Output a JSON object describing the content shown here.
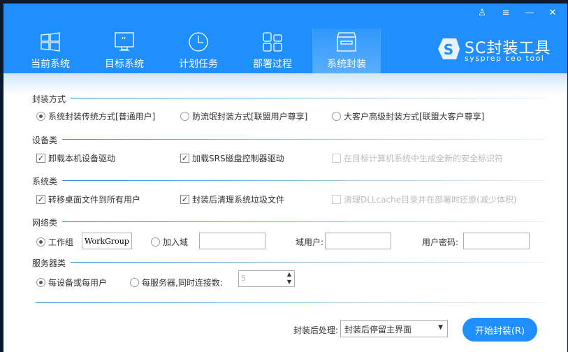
{
  "window": {
    "controls": [
      "user-icon",
      "menu-icon",
      "minimize-icon",
      "close-icon"
    ],
    "control_glyphs": [
      "♙",
      "≡",
      "—",
      "✕"
    ]
  },
  "tabs": [
    {
      "label": "当前系统",
      "icon": "windows-icon"
    },
    {
      "label": "目标系统",
      "icon": "monitor-icon"
    },
    {
      "label": "计划任务",
      "icon": "clock-icon"
    },
    {
      "label": "部署过程",
      "icon": "grid-icon"
    },
    {
      "label": "系统封装",
      "icon": "box-icon",
      "active": true
    }
  ],
  "logo": {
    "title": "SC封装工具",
    "subtitle": "sysprep ceo tool"
  },
  "sections": {
    "mode": {
      "title": "封装方式",
      "options": [
        "系统封装传统方式[普通用户]",
        "防流氓封装方式[联盟用户尊享]",
        "大客户高级封装方式[联盟大客户尊享]"
      ],
      "selected": 0
    },
    "device": {
      "title": "设备类",
      "options": [
        {
          "label": "卸载本机设备驱动",
          "checked": true
        },
        {
          "label": "加载SRS磁盘控制器驱动",
          "checked": true
        },
        {
          "label": "在目标计算机系统中生成全新的安全标识符",
          "checked": false,
          "disabled": true
        }
      ]
    },
    "system": {
      "title": "系统类",
      "options": [
        {
          "label": "转移桌面文件到所有用户",
          "checked": true
        },
        {
          "label": "封装后清理系统垃圾文件",
          "checked": true
        },
        {
          "label": "清理DLLcache目录并在部署时还原(减少体积)",
          "checked": false,
          "disabled": true
        }
      ]
    },
    "network": {
      "title": "网络类",
      "workgroup_label": "工作组",
      "workgroup_value": "WorkGroup",
      "domain_label": "加入域",
      "domain_value": "",
      "domain_user_label": "域用户:",
      "domain_user_value": "",
      "password_label": "用户密码:",
      "password_value": ""
    },
    "server": {
      "title": "服务器类",
      "option1": "每设备或每用户",
      "option2": "每服务器,同时连接数:",
      "connections": "5"
    }
  },
  "footer": {
    "post_label": "封装后处理:",
    "post_value": "封装后停留主界面",
    "start_button": "开始封装(R)"
  }
}
